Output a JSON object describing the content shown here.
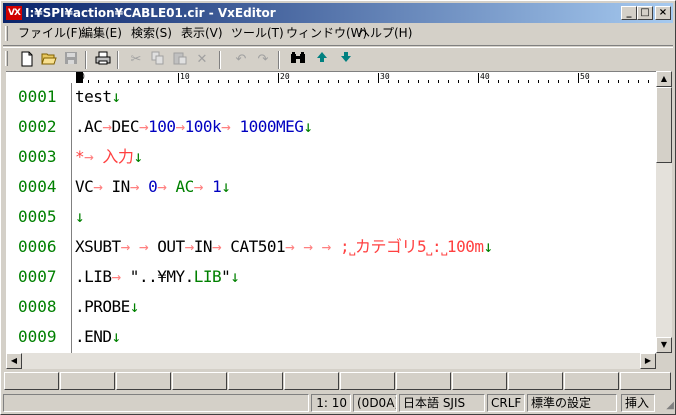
{
  "window": {
    "title": "I:¥SPI¥action¥CABLE01.cir - VxEditor",
    "app_icon_text": "VX",
    "minimize": "_",
    "maximize": "□",
    "close": "×"
  },
  "menu": [
    "ファイル(F)",
    "編集(E)",
    "検索(S)",
    "表示(V)",
    "ツール(T)",
    "ウィンドウ(W)",
    "ヘルプ(H)"
  ],
  "toolbar": {
    "new": "new-file-icon",
    "open": "open-folder-icon",
    "save": "save-icon",
    "print": "print-icon",
    "cut": "cut-icon",
    "copy": "copy-icon",
    "paste": "paste-icon",
    "delete": "delete-icon",
    "undo": "undo-icon",
    "redo": "redo-icon",
    "find": "binoculars-icon",
    "up": "arrow-up-icon",
    "down": "arrow-down-icon"
  },
  "ruler": {
    "labels": [
      "0",
      "10",
      "20",
      "30",
      "40",
      "50"
    ]
  },
  "editor": {
    "lines": [
      {
        "num": "0001",
        "parts": [
          [
            "k",
            "test"
          ],
          [
            "eol",
            "↓"
          ]
        ]
      },
      {
        "num": "0002",
        "parts": [
          [
            "k",
            ".AC"
          ],
          [
            "tab",
            "→"
          ],
          [
            "k",
            "DEC"
          ],
          [
            "tab",
            "→"
          ],
          [
            "b",
            "100"
          ],
          [
            "tab",
            "→"
          ],
          [
            "b",
            "100k"
          ],
          [
            "tab",
            "→"
          ],
          [
            "k",
            "   "
          ],
          [
            "b",
            "1000MEG"
          ],
          [
            "eol",
            "↓"
          ]
        ]
      },
      {
        "num": "0003",
        "parts": [
          [
            "r",
            "*"
          ],
          [
            "tab",
            "→"
          ],
          [
            "k",
            "  "
          ],
          [
            "r",
            "入力"
          ],
          [
            "eol",
            "↓"
          ]
        ]
      },
      {
        "num": "0004",
        "parts": [
          [
            "k",
            "VC"
          ],
          [
            "tab",
            "→"
          ],
          [
            "k",
            " IN"
          ],
          [
            "tab",
            "→"
          ],
          [
            "k",
            " "
          ],
          [
            "b",
            "0"
          ],
          [
            "tab",
            "→"
          ],
          [
            "k",
            "  "
          ],
          [
            "g",
            "AC"
          ],
          [
            "tab",
            "→"
          ],
          [
            "k",
            " "
          ],
          [
            "b",
            "1"
          ],
          [
            "eol",
            "↓"
          ]
        ]
      },
      {
        "num": "0005",
        "parts": [
          [
            "eol",
            "↓"
          ]
        ]
      },
      {
        "num": "0006",
        "parts": [
          [
            "k",
            "XSUBT"
          ],
          [
            "tab",
            "→"
          ],
          [
            "k",
            "  "
          ],
          [
            "tab",
            "→"
          ],
          [
            "k",
            "   OUT"
          ],
          [
            "tab",
            "→"
          ],
          [
            "k",
            "IN"
          ],
          [
            "tab",
            "→"
          ],
          [
            "k",
            " CAT501"
          ],
          [
            "tab",
            "→"
          ],
          [
            "k",
            " "
          ],
          [
            "tab",
            "→"
          ],
          [
            "k",
            "  "
          ],
          [
            "tab",
            "→"
          ],
          [
            "k",
            "   "
          ],
          [
            "r",
            ";˽カテゴリ5˽:˽100m"
          ],
          [
            "eol",
            "↓"
          ]
        ]
      },
      {
        "num": "0007",
        "parts": [
          [
            "k",
            ".LIB"
          ],
          [
            "tab",
            "→"
          ],
          [
            "k",
            "   \"..¥MY."
          ],
          [
            "g",
            "LIB"
          ],
          [
            "k",
            "\""
          ],
          [
            "eol",
            "↓"
          ]
        ]
      },
      {
        "num": "0008",
        "parts": [
          [
            "k",
            ".PROBE"
          ],
          [
            "eol",
            "↓"
          ]
        ]
      },
      {
        "num": "0009",
        "parts": [
          [
            "k",
            ".END"
          ],
          [
            "eol",
            "↓"
          ]
        ]
      }
    ]
  },
  "status": {
    "position": "1: 10",
    "code": "(0D0A)",
    "encoding": "日本語 SJIS",
    "newline": "CRLF",
    "settings": "標準の設定",
    "mode": "挿入"
  },
  "fkeys_count": 12
}
